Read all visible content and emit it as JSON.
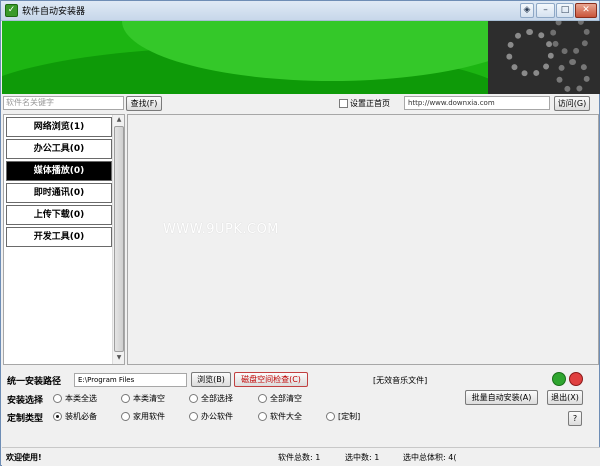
{
  "window": {
    "title": "软件自动安装器"
  },
  "search": {
    "placeholder": "软件名关键字",
    "button": "查找(F)"
  },
  "homepage": {
    "checkbox_label": "设置正首页",
    "url": "http://www.downxia.com",
    "visit_button": "访问(G)"
  },
  "categories": [
    {
      "label": "网络浏览(1)"
    },
    {
      "label": "办公工具(0)"
    },
    {
      "label": "媒体播放(0)"
    },
    {
      "label": "即时通讯(0)"
    },
    {
      "label": "上传下载(0)"
    },
    {
      "label": "开发工具(0)"
    }
  ],
  "selected_category": "媒体播放(0)",
  "watermark": "WWW.9UPK.COM",
  "install": {
    "path_label": "统一安装路径",
    "path_value": "E:\\Program Files",
    "browse_button": "浏览(B)",
    "disk_check_button": "磁盘空间检查(C)",
    "music_note": "[无效音乐文件]",
    "choice_label": "安装选择",
    "choices": [
      "本类全选",
      "本类清空",
      "全部选择",
      "全部清空"
    ],
    "type_label": "定制类型",
    "types": [
      "装机必备",
      "家用软件",
      "办公软件",
      "软件大全",
      "[定制]"
    ],
    "selected_type": "装机必备",
    "batch_button": "批量自动安装(A)",
    "exit_button": "退出(X)",
    "help_button": "?"
  },
  "status": {
    "welcome": "欢迎使用!",
    "total": "软件总数: 1",
    "selected": "选中数: 1",
    "selected_size": "选中总体积: 4("
  },
  "colors": {
    "banner": "#1cb512",
    "active_category": "#000000"
  }
}
